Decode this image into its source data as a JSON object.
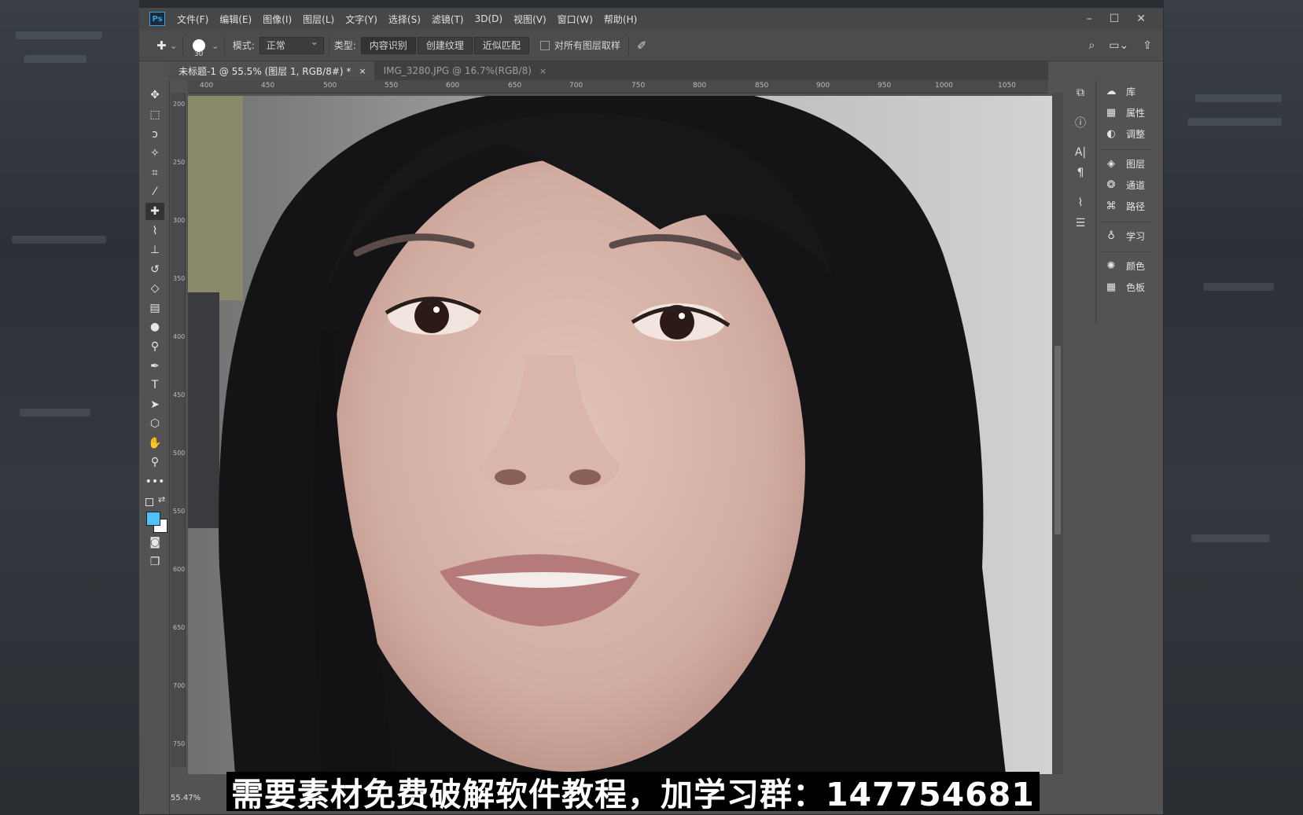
{
  "window": {
    "app_badge": "Ps",
    "minimize": "–",
    "maximize": "☐",
    "close": "✕"
  },
  "menu": [
    "文件(F)",
    "编辑(E)",
    "图像(I)",
    "图层(L)",
    "文字(Y)",
    "选择(S)",
    "滤镜(T)",
    "3D(D)",
    "视图(V)",
    "窗口(W)",
    "帮助(H)"
  ],
  "options": {
    "brush_size": "30",
    "mode_label": "模式:",
    "mode_value": "正常",
    "type_label": "类型:",
    "type_buttons": [
      "内容识别",
      "创建纹理",
      "近似匹配"
    ],
    "sample_all_label": "对所有图层取样"
  },
  "tabs": [
    {
      "label": "未标题-1 @ 55.5% (图层 1, RGB/8#) *",
      "close": "×",
      "active": true
    },
    {
      "label": "IMG_3280.JPG @ 16.7%(RGB/8)",
      "close": "×",
      "active": false
    }
  ],
  "ruler": {
    "top_ticks": [
      "400",
      "450",
      "500",
      "550",
      "600",
      "650",
      "700",
      "750",
      "800",
      "850",
      "900",
      "950",
      "1000",
      "1050"
    ],
    "left_ticks": [
      "200",
      "250",
      "300",
      "350",
      "400",
      "450",
      "500",
      "550",
      "600",
      "650",
      "700",
      "750"
    ]
  },
  "status": {
    "zoom": "55.47%"
  },
  "panels": [
    {
      "icon": "cloud-library-icon",
      "label": "库"
    },
    {
      "icon": "properties-icon",
      "label": "属性"
    },
    {
      "icon": "adjustments-icon",
      "label": "调整"
    },
    {
      "icon": "layers-icon",
      "label": "图层"
    },
    {
      "icon": "channels-icon",
      "label": "通道"
    },
    {
      "icon": "paths-icon",
      "label": "路径"
    },
    {
      "icon": "learn-icon",
      "label": "学习"
    },
    {
      "icon": "color-icon",
      "label": "颜色"
    },
    {
      "icon": "swatches-icon",
      "label": "色板"
    }
  ],
  "colors": {
    "foreground": "#4fc3f7",
    "background": "#ffffff",
    "accent": "#2fa3e6"
  },
  "caption": "需要素材免费破解软件教程，加学习群：147754681"
}
